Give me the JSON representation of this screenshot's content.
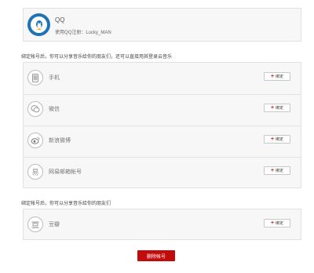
{
  "qq": {
    "name": "QQ",
    "sub": "使用QQ注册：Lucky_MAN"
  },
  "section1_label": "绑定帐号后，你可以分享音乐给你的朋友们，还可以直接用其登录云音乐",
  "section2_label": "绑定帐号后，你可以分享音乐给你的朋友们",
  "accounts": [
    {
      "label": "手机",
      "icon": "phone-icon",
      "button": "绑定"
    },
    {
      "label": "微信",
      "icon": "wechat-icon",
      "button": "绑定"
    },
    {
      "label": "新浪微博",
      "icon": "weibo-icon",
      "button": "绑定"
    },
    {
      "label": "网易邮箱帐号",
      "icon": "netease-mail-icon",
      "button": "绑定"
    }
  ],
  "douban": {
    "label": "豆瓣",
    "icon": "douban-icon",
    "button": "绑定"
  },
  "delete_label": "删除帐号",
  "colors": {
    "accent": "#c20c0c",
    "qq_blue": "#1e73b6"
  }
}
